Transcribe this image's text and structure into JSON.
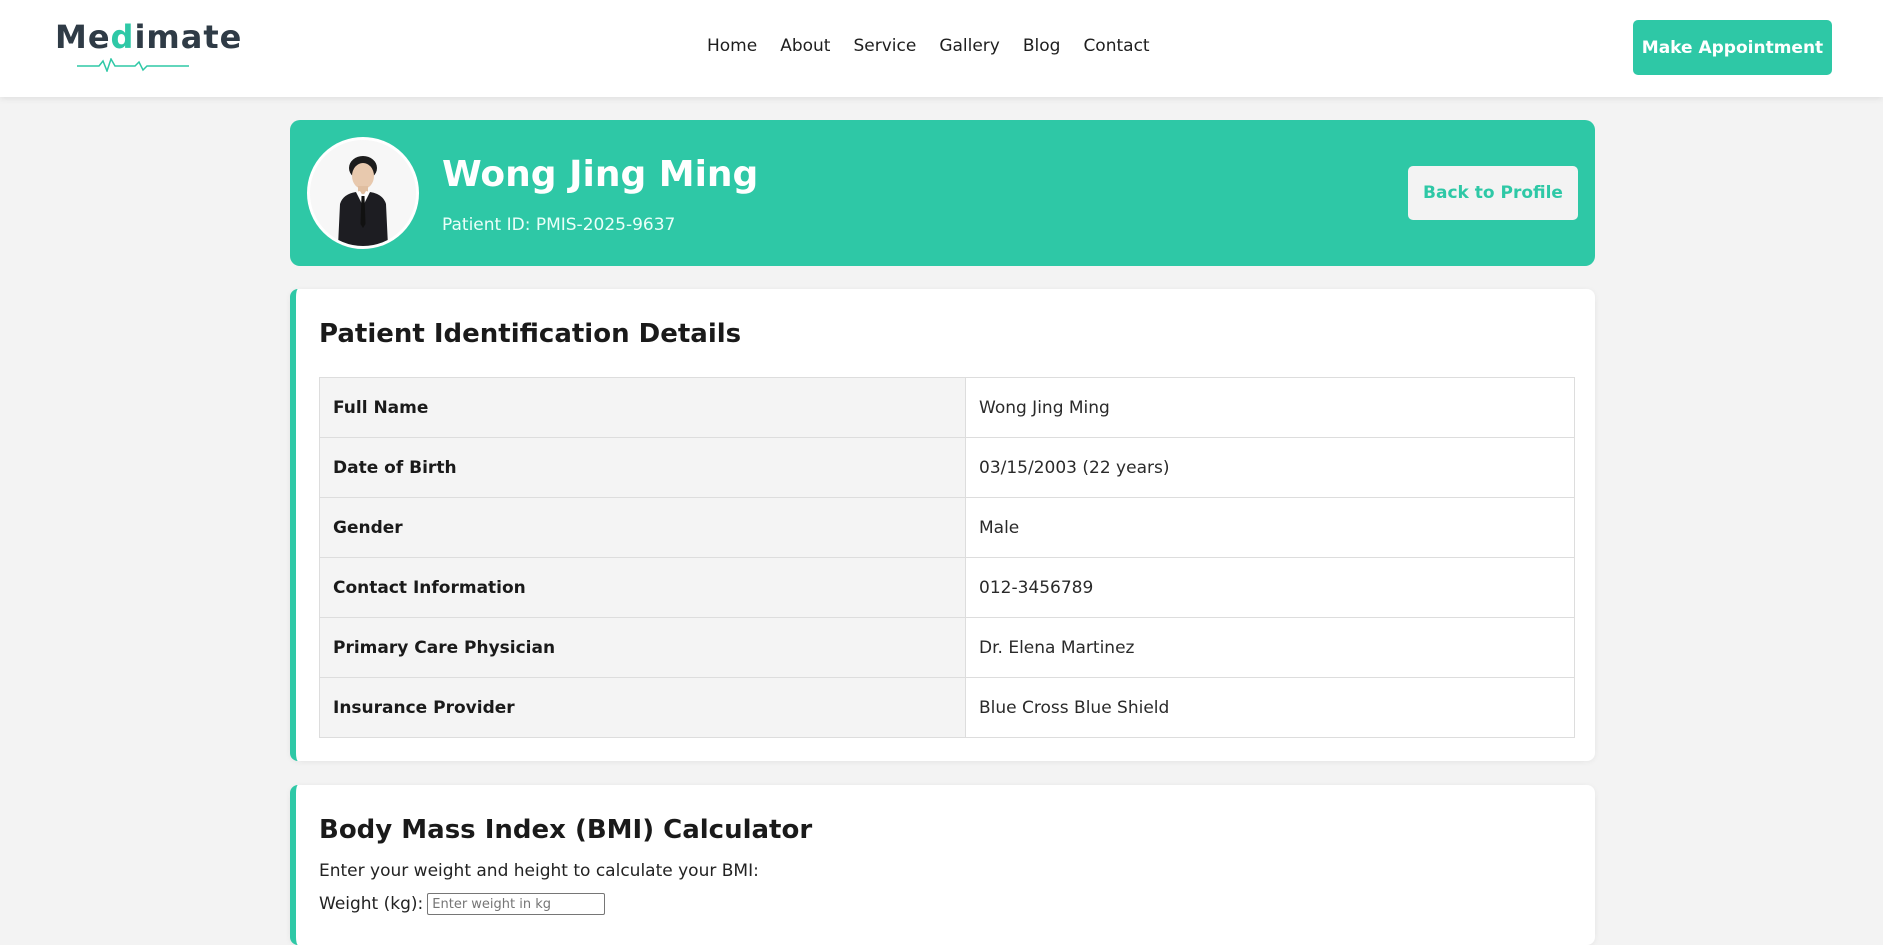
{
  "logo": {
    "text_main": "Me",
    "text_accent": "d",
    "text_end": "imate"
  },
  "nav": {
    "links": [
      "Home",
      "About",
      "Service",
      "Gallery",
      "Blog",
      "Contact"
    ],
    "appointment_label": "Make Appointment"
  },
  "header": {
    "name": "Wong Jing Ming",
    "patient_id": "Patient ID: PMIS-2025-9637",
    "back_label": "Back to Profile"
  },
  "details": {
    "title": "Patient Identification Details",
    "rows": [
      {
        "label": "Full Name",
        "value": "Wong Jing Ming"
      },
      {
        "label": "Date of Birth",
        "value": "03/15/2003 (22 years)"
      },
      {
        "label": "Gender",
        "value": "Male"
      },
      {
        "label": "Contact Information",
        "value": "012-3456789"
      },
      {
        "label": "Primary Care Physician",
        "value": "Dr. Elena Martinez"
      },
      {
        "label": "Insurance Provider",
        "value": "Blue Cross Blue Shield"
      }
    ]
  },
  "bmi": {
    "title": "Body Mass Index (BMI) Calculator",
    "intro": "Enter your weight and height to calculate your BMI:",
    "weight_label": "Weight (kg):",
    "weight_placeholder": "Enter weight in kg"
  },
  "colors": {
    "accent": "#2ec8a6",
    "background": "#f3f3f3",
    "dark": "#2f3b46"
  }
}
